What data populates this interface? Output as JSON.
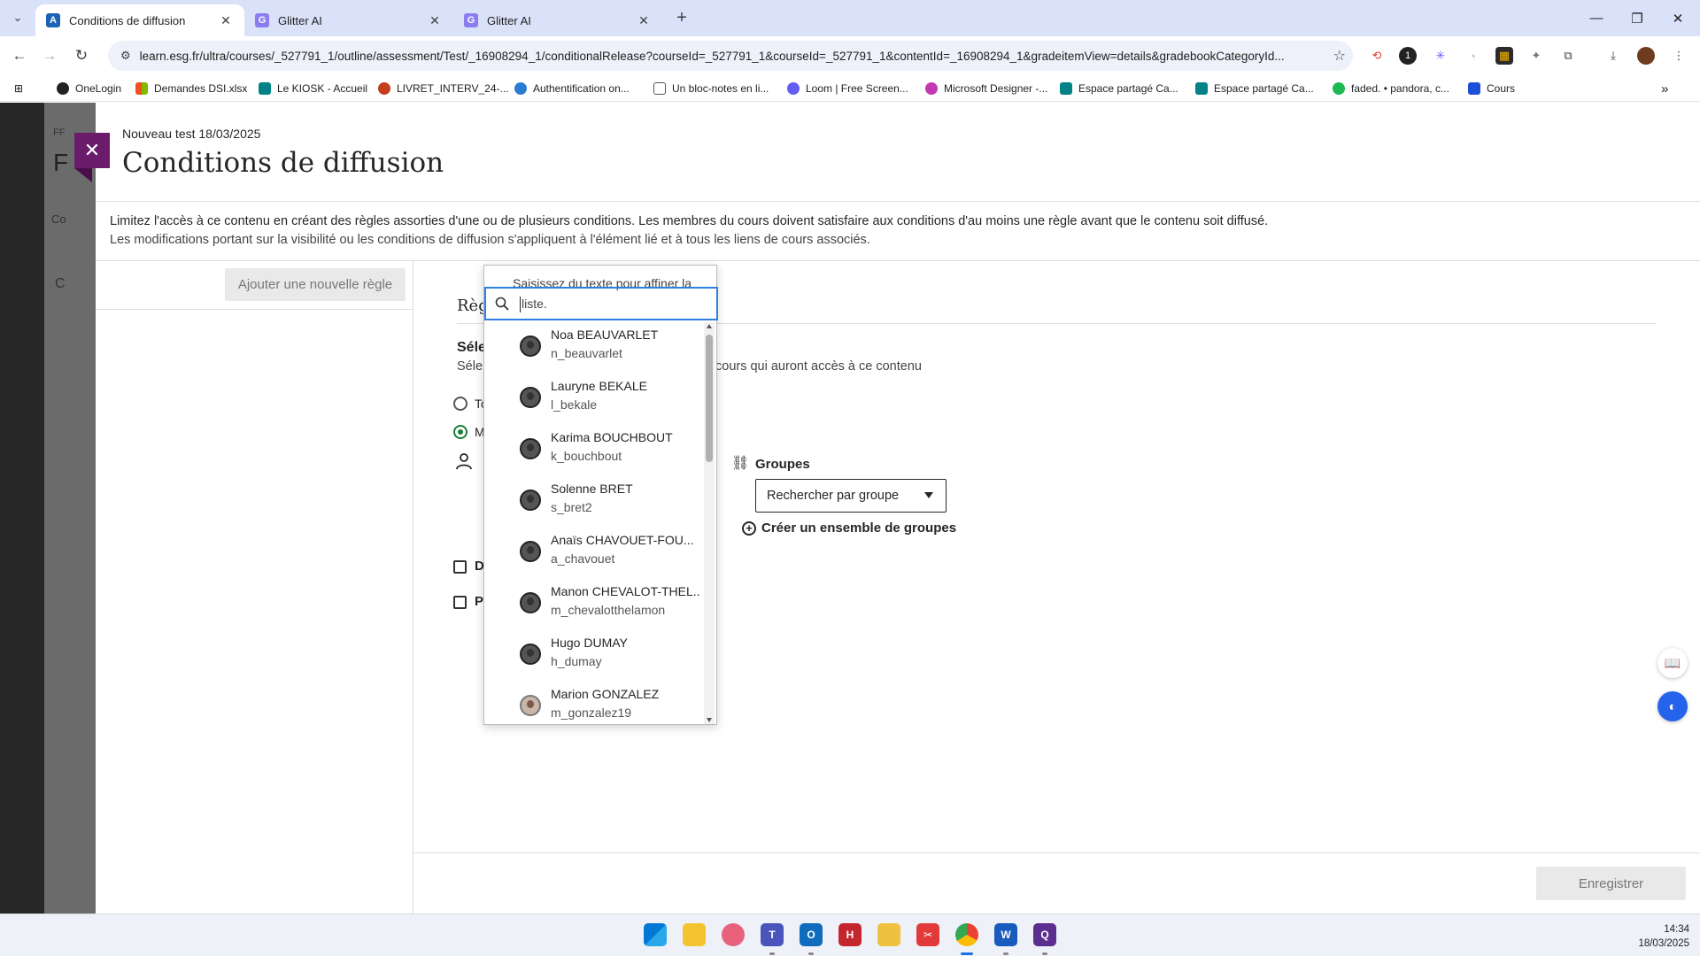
{
  "browser": {
    "tabs": [
      {
        "label": "Conditions de diffusion",
        "active": true,
        "favicon": "anthology-icon"
      },
      {
        "label": "Glitter AI",
        "active": false,
        "favicon": "glitter-icon"
      },
      {
        "label": "Glitter AI",
        "active": false,
        "favicon": "glitter-icon"
      }
    ],
    "url": "learn.esg.fr/ultra/courses/_527791_1/outline/assessment/Test/_16908294_1/conditionalRelease?courseId=_527791_1&courseId=_527791_1&contentId=_16908294_1&gradeitemView=details&gradebookCategoryId...",
    "bookmarks": [
      {
        "label": "OneLogin",
        "color": "#222222"
      },
      {
        "label": "Demandes DSI.xlsx",
        "color": "#f25022"
      },
      {
        "label": "Le KIOSK - Accueil",
        "color": "#038387"
      },
      {
        "label": "LIVRET_INTERV_24-...",
        "color": "#c43e1c"
      },
      {
        "label": "Authentification on...",
        "color": "#2b7cd3"
      },
      {
        "label": "Un bloc-notes en li...",
        "color": "#555555"
      },
      {
        "label": "Loom | Free Screen...",
        "color": "#625df5"
      },
      {
        "label": "Microsoft Designer -...",
        "color": "#c239b3"
      },
      {
        "label": "Espace partagé Ca...",
        "color": "#038387"
      },
      {
        "label": "Espace partagé Ca...",
        "color": "#038387"
      },
      {
        "label": "faded. • pandora, c...",
        "color": "#1db954"
      },
      {
        "label": "Cours",
        "color": "#1d4ed8"
      }
    ]
  },
  "page": {
    "crumb": "Nouveau test 18/03/2025",
    "title": "Conditions de diffusion",
    "description_line1": "Limitez l'accès à ce contenu en créant des règles assorties d'une ou de plusieurs conditions. Les membres du cours doivent satisfaire aux conditions d'au moins une règle avant que le contenu soit diffusé.",
    "description_line2": "Les modifications portant sur la visibilité ou les conditions de diffusion s'appliquent à l'élément lié et à tous les liens de cours associés.",
    "add_rule_label": "Ajouter une nouvelle règle",
    "rule_title_partial": "Règ",
    "select_title_partial": "Séle",
    "select_sub_partial": "Séle",
    "select_sub_right": "cours qui auront accès à ce contenu",
    "radio_1_partial": "To",
    "radio_2_partial": "M",
    "checkbox_1_partial": "D",
    "checkbox_2_partial": "P",
    "groups_label": "Groupes",
    "groups_select_value": "Rechercher par groupe",
    "create_group_set_label": "Créer un ensemble de groupes",
    "save_label": "Enregistrer",
    "under_text_1": "FF",
    "under_text_2": "F",
    "under_text_3": "Co",
    "under_text_4": "C",
    "under_text_5": "C"
  },
  "dropdown": {
    "placeholder_line1": "Saisissez du texte pour affiner la",
    "placeholder_line2": "liste.",
    "members": [
      {
        "name": "Noa BEAUVARLET",
        "username": "n_beauvarlet",
        "photo": false
      },
      {
        "name": "Lauryne BEKALE",
        "username": "l_bekale",
        "photo": false
      },
      {
        "name": "Karima BOUCHBOUT",
        "username": "k_bouchbout",
        "photo": false
      },
      {
        "name": "Solenne BRET",
        "username": "s_bret2",
        "photo": false
      },
      {
        "name": "Anaïs CHAVOUET-FOU...",
        "username": "a_chavouet",
        "photo": false
      },
      {
        "name": "Manon CHEVALOT-THEL...",
        "username": "m_chevalotthelamon",
        "photo": false
      },
      {
        "name": "Hugo DUMAY",
        "username": "h_dumay",
        "photo": false
      },
      {
        "name": "Marion GONZALEZ",
        "username": "m_gonzalez19",
        "photo": true
      }
    ]
  },
  "taskbar": {
    "time": "14:34",
    "date": "18/03/2025"
  }
}
